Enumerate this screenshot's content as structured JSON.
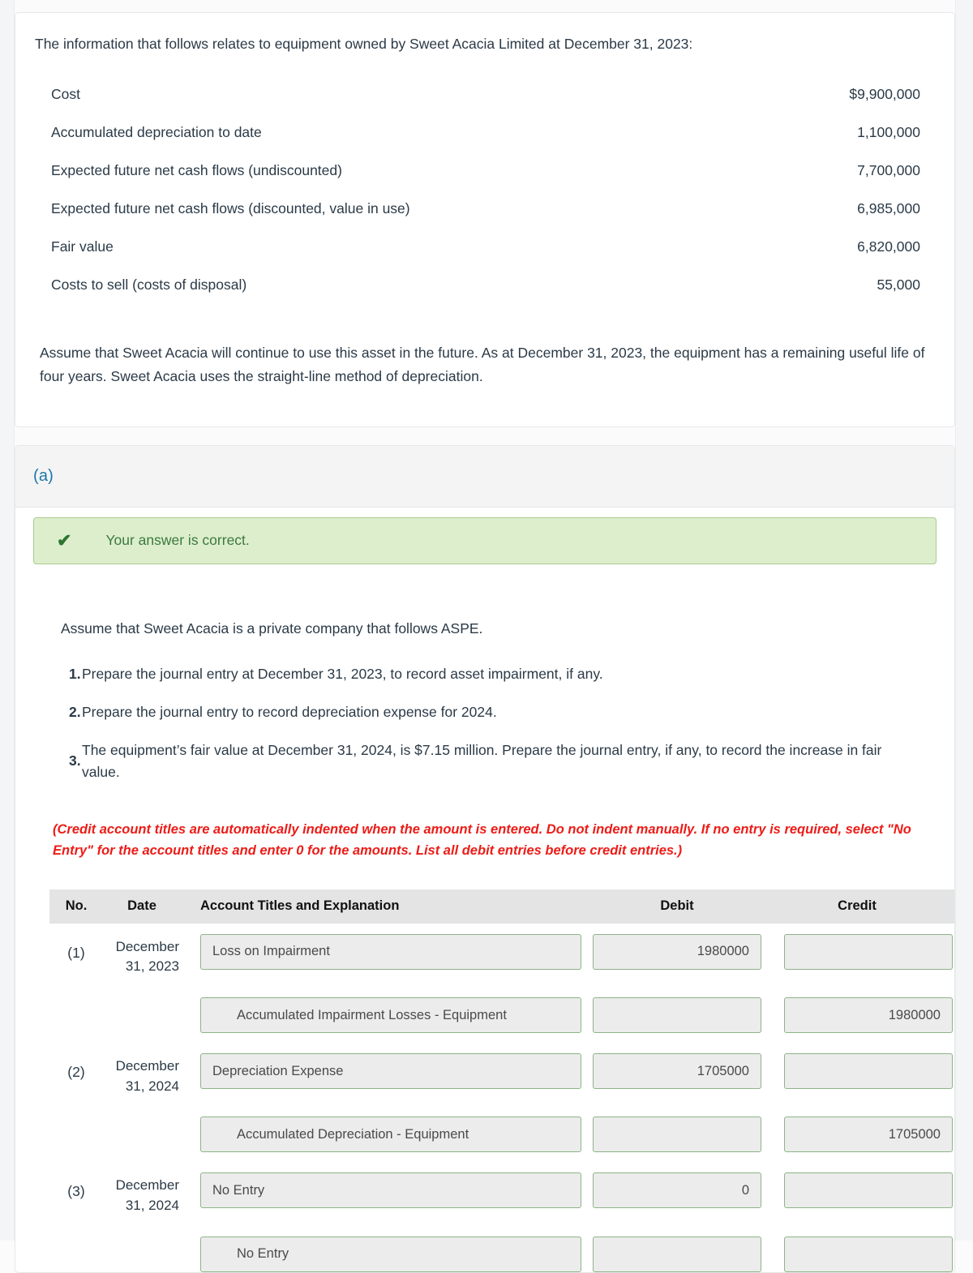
{
  "problem": {
    "intro": "The information that follows relates to equipment owned by Sweet Acacia Limited at December 31, 2023:",
    "facts": [
      {
        "label": "Cost",
        "value": "$9,900,000"
      },
      {
        "label": "Accumulated depreciation to date",
        "value": "1,100,000"
      },
      {
        "label": "Expected future net cash flows (undiscounted)",
        "value": "7,700,000"
      },
      {
        "label": "Expected future net cash flows (discounted, value in use)",
        "value": "6,985,000"
      },
      {
        "label": "Fair value",
        "value": "6,820,000"
      },
      {
        "label": "Costs to sell (costs of disposal)",
        "value": "55,000"
      }
    ],
    "assumption": "Assume that Sweet Acacia will continue to use this asset in the future. As at December 31, 2023, the equipment has a remaining useful life of four years. Sweet Acacia uses the straight-line method of depreciation."
  },
  "part": {
    "letter": "(a)",
    "alert": {
      "icon": "check-icon",
      "text": "Your answer is correct."
    },
    "aspe_line": "Assume that Sweet Acacia is a private company that follows ASPE.",
    "steps": [
      {
        "num": "1.",
        "text": "Prepare the journal entry at December 31, 2023, to record asset impairment, if any."
      },
      {
        "num": "2.",
        "text": "Prepare the journal entry to record depreciation expense for 2024."
      },
      {
        "num": "3.",
        "text": "The equipment’s fair value at December 31, 2024, is $7.15 million. Prepare the journal entry, if any, to record the increase in fair value."
      }
    ],
    "credit_note": "(Credit account titles are automatically indented when the amount is entered. Do not indent manually. If no entry is required, select \"No Entry\" for the account titles and enter 0 for the amounts. List all debit entries before credit entries.)"
  },
  "journal": {
    "headers": {
      "no": "No.",
      "date": "Date",
      "account": "Account Titles and Explanation",
      "debit": "Debit",
      "credit": "Credit"
    },
    "entries": [
      {
        "no": "(1)",
        "date_line1": "December",
        "date_line2": "31, 2023",
        "debit_row": {
          "account": "Loss on Impairment",
          "debit": "1980000",
          "credit": ""
        },
        "credit_row": {
          "account": "Accumulated Impairment Losses - Equipment",
          "debit": "",
          "credit": "1980000"
        }
      },
      {
        "no": "(2)",
        "date_line1": "December",
        "date_line2": "31, 2024",
        "debit_row": {
          "account": "Depreciation Expense",
          "debit": "1705000",
          "credit": ""
        },
        "credit_row": {
          "account": "Accumulated Depreciation - Equipment",
          "debit": "",
          "credit": "1705000"
        }
      },
      {
        "no": "(3)",
        "date_line1": "December",
        "date_line2": "31, 2024",
        "debit_row": {
          "account": "No Entry",
          "debit": "0",
          "credit": ""
        },
        "credit_row": {
          "account": "No Entry",
          "debit": "",
          "credit": ""
        }
      }
    ]
  },
  "colors": {
    "accent_blue": "#1b76a8",
    "alert_green_bg": "#ddeecd",
    "alert_green_text": "#3b7a3e",
    "note_red": "#ec1c17",
    "field_border_green": "#8db487",
    "text": "#2b3a47"
  }
}
